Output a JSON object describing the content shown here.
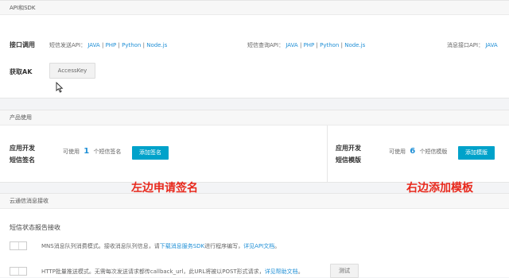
{
  "api_panel": {
    "header": "API和SDK",
    "call_label": "接口调用",
    "groups": [
      {
        "label": "短信发送API：",
        "links": [
          "JAVA",
          "PHP",
          "Python",
          "Node.js"
        ]
      },
      {
        "label": "短信查询API：",
        "links": [
          "JAVA",
          "PHP",
          "Python",
          "Node.js"
        ]
      },
      {
        "label": "消息接口API：",
        "links": [
          "JAVA"
        ]
      }
    ],
    "ak_label": "获取AK",
    "ak_button": "AccessKey"
  },
  "product_panel": {
    "header": "产品使用",
    "left": {
      "title_line1": "应用开发",
      "title_line2": "短信签名",
      "prefix": "可使用",
      "count": "1",
      "suffix": "个短信签名",
      "button": "添加签名"
    },
    "right": {
      "title_line1": "应用开发",
      "title_line2": "短信模版",
      "prefix": "可使用",
      "count": "6",
      "suffix": "个短信模版",
      "button": "添加模版"
    }
  },
  "annotations": {
    "left": "左边申请签名",
    "right": "右边添加模板"
  },
  "receive_panel": {
    "header": "云通信消息接收",
    "subtitle": "短信状态报告接收",
    "rows": [
      {
        "pre": "MNS消息队列消费模式。接收消息队列信息，请",
        "link1": "下载消息服务SDK",
        "mid": "进行程序编写，",
        "link2": "详见API文档",
        "post": "。"
      },
      {
        "pre": "HTTP批量推送模式。无需每次发送请求都传callback_url，此URL将被以POST形式请求，",
        "link2": "详见帮助文档",
        "post": "。",
        "button": "测试"
      }
    ]
  },
  "separator": "|"
}
